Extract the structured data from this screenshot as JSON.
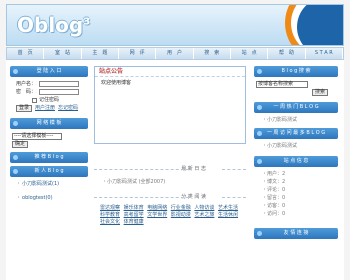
{
  "header": {
    "logo": "Oblog",
    "logo_sup": "3"
  },
  "nav": {
    "items": [
      "首　页",
      "室　站",
      "主　题",
      "网　评",
      "用　户",
      "搜　索",
      "站　点",
      "帮　助",
      "S T A R"
    ]
  },
  "left": {
    "login_title": "登 陆 入 口",
    "username_label": "用户名：",
    "password_label": "密　码：",
    "remember": "记住密码",
    "login_button": "登录",
    "register_link": "用户注册",
    "forgot_link": "忘记密码",
    "mode_title": "网 络 模 板",
    "mode_select": "----请选择模板----",
    "mode_button": "确定",
    "recommend_title": "推 荐 B l o g",
    "new_title": "新 人 B l o g",
    "new_items": [
      "小刀影码测试(1)",
      "oblogtest(0)"
    ]
  },
  "mid": {
    "notice_title": "站点公告",
    "notice_text": "欢迎使用博客",
    "latest_title": "最 新 日 志",
    "latest_items": [
      "小刀影码测试 (全部2007)"
    ],
    "cat_title": "分 类 阅 读",
    "categories": [
      "雷达观察",
      "娱乐体育",
      "电脑网络",
      "行业金融",
      "人物访谈",
      "艺术生活",
      "科学教育",
      "高考留学",
      "文学世界",
      "影视动漫",
      "艺术之旅",
      "生活休闲",
      "社会文化",
      "体育健康"
    ]
  },
  "right": {
    "search_title": "B l o g 搜 索",
    "search_select": "按博客名称搜索",
    "search_button": "搜索",
    "hot_title": "一 周 热 门 B L O G",
    "hot_items": [
      "小刀影码测试"
    ],
    "recent_title": "一 周 访 问 最 多 B L O G",
    "recent_items": [
      "小刀影码测试"
    ],
    "stats_title": "站 点 信 息",
    "stats_items": [
      "用户：2",
      "博文：2",
      "评论：0",
      "留言：0",
      "访客：0",
      "访问：0"
    ],
    "friend_title": "友 情 连 接"
  }
}
